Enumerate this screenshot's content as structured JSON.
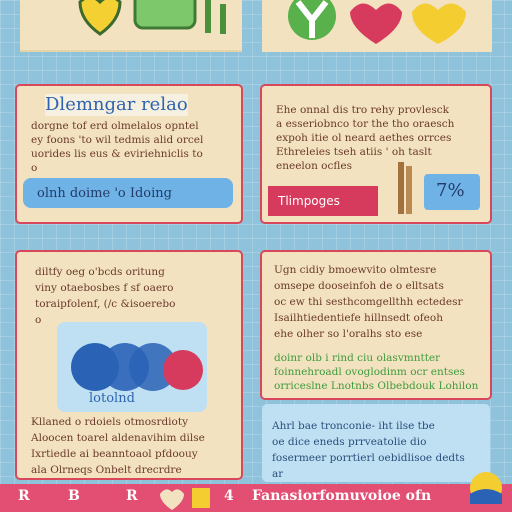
{
  "panels": {
    "top_left": {
      "heading": "Dlemngar relao",
      "lines": [
        "dorgne tof erd olmelalos opntel",
        "ey foons 'to wil tedmis alid orcel",
        "uorides lis eus & eviriehniclis to",
        "o"
      ],
      "pill_label": "olnh doime 'o Idoing"
    },
    "top_right": {
      "lines": [
        "Ehe onnal dis tro rehy provlesck",
        "a esseriobnco tor the tho oraesch",
        "expoh itie ol neard aethes orrces",
        "Ethreleies tseh atiis ' oh taslt",
        "eneelon ocfles"
      ],
      "tag_label": "Tlimpoges",
      "stat": "7%"
    },
    "mid_left": {
      "lines": [
        "diltfy oeg o'bcds oritung",
        "viny otaebosbes f sf oaero",
        "toraipfolenf, (/c &isoerebo",
        "o"
      ],
      "caption": "lotolnd",
      "bottom_lines": [
        "Kllaned o rdoiels otmosrdioty",
        "Aloocen toarel aldenavihim dilse",
        "Ixrtiedle ai beanntoaol pfdoouy",
        "ala Olrneqs Onbelt drecrdre"
      ]
    },
    "mid_right": {
      "lines": [
        "Ugn cidiy bmoewvito olmtesre",
        "omsepe dooseinfoh de o elltsats",
        "oc ew thi sesthcomgellthh ectedesr",
        "Isailhtiedentiefe hillnsedt ofeoh",
        "ehe olher so l'oralhs sto ese"
      ],
      "green_lines": [
        "doinr olb i rind ciu olasvmntter",
        "foinnehroadl ovoglodinm ocr entses",
        "orriceslne Lnotnbs Olbebdouk Lohilon"
      ]
    },
    "bottom_right": {
      "lines": [
        "Ahrl bae tronconie- iht ilse tbe",
        "oe dice eneds prrveatolie dio",
        "fosermeer porrtierl oebidlisoe dedts",
        "ar"
      ]
    }
  },
  "bottom_bar": {
    "letters": [
      "R",
      "B",
      "R",
      "4"
    ],
    "label": "Fanasiorfomuvoioe ofn"
  },
  "colors": {
    "background": "#8fc3dc",
    "panel": "#f3e2c0",
    "accent_red": "#d8485a",
    "accent_blue": "#2f63b0",
    "accent_green": "#3f9b3e"
  }
}
